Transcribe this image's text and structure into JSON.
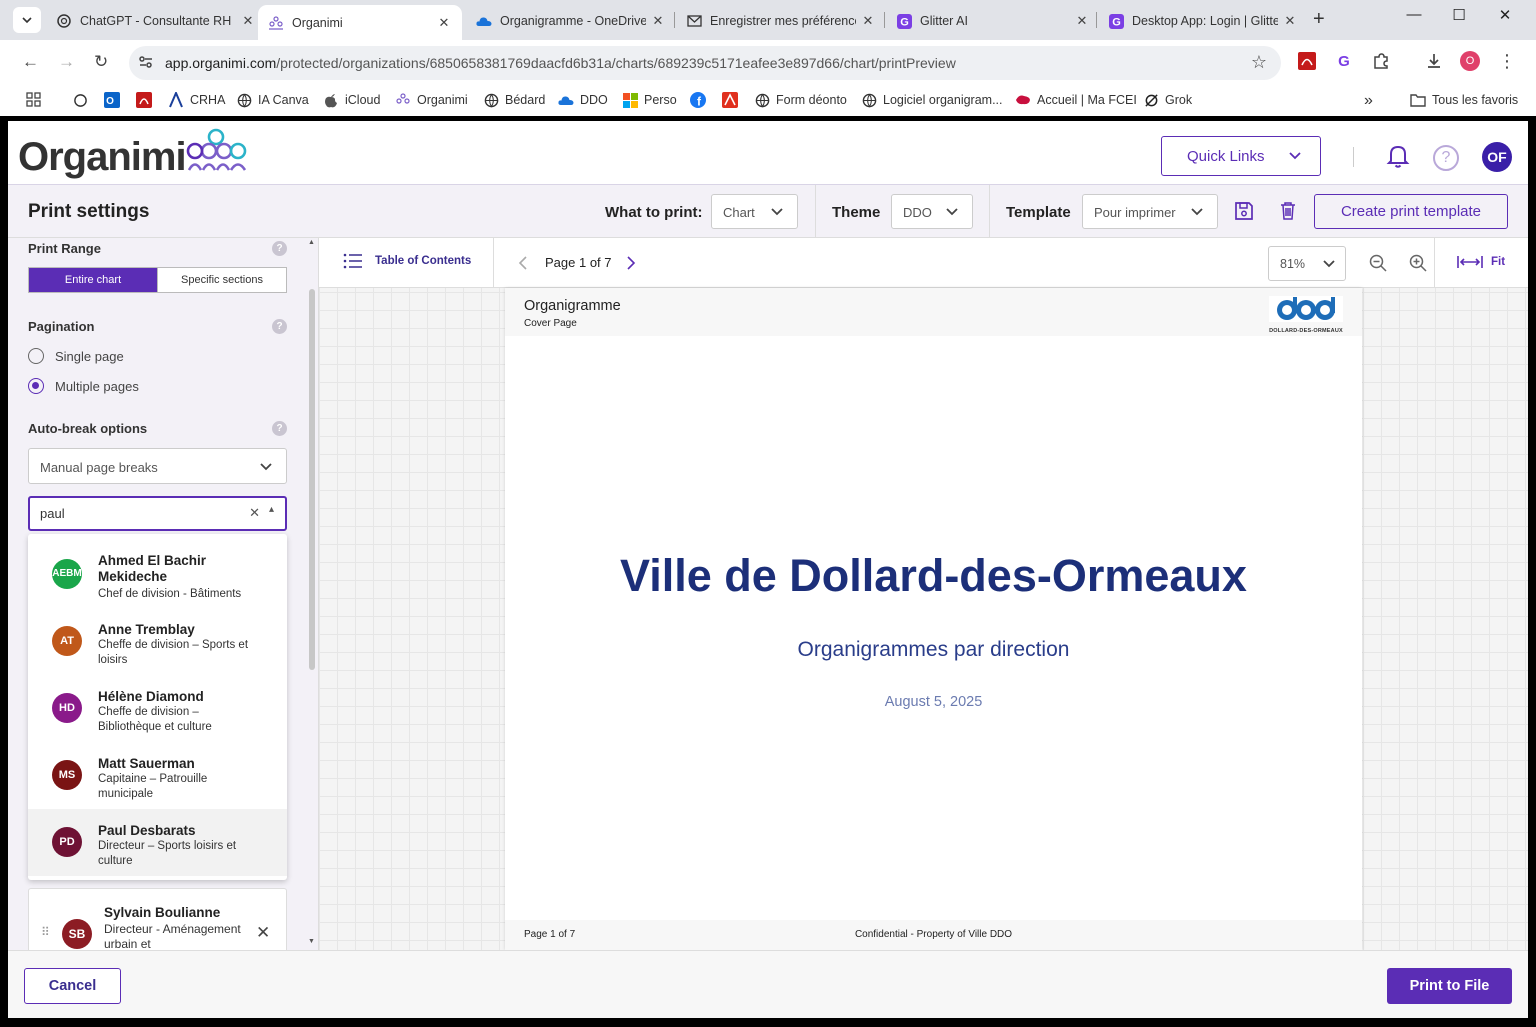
{
  "browser": {
    "tabs": [
      {
        "title": "ChatGPT - Consultante RH",
        "icon": "chatgpt-icon",
        "active": false
      },
      {
        "title": "Organimi",
        "icon": "organimi-icon",
        "active": true
      },
      {
        "title": "Organigramme - OneDrive",
        "icon": "onedrive-icon",
        "active": false
      },
      {
        "title": "Enregistrer mes préférences",
        "icon": "mail-icon",
        "active": false
      },
      {
        "title": "Glitter AI",
        "icon": "glitter-icon",
        "active": false
      },
      {
        "title": "Desktop App: Login | Glitter",
        "icon": "glitter-icon",
        "active": false
      }
    ],
    "url_domain": "app.organimi.com",
    "url_path": "/protected/organizations/6850658381769daacfd6b31a/charts/689239c5171eafee3e897d66/chart/printPreview",
    "profile_initial": "O",
    "bookmarks": [
      {
        "label": "",
        "icon": "chatgpt-icon"
      },
      {
        "label": "",
        "icon": "outlook-icon"
      },
      {
        "label": "",
        "icon": "pdf-icon"
      },
      {
        "label": "CRHA",
        "icon": "crha-icon"
      },
      {
        "label": "IA Canva",
        "icon": "globe-icon"
      },
      {
        "label": "iCloud",
        "icon": "apple-icon"
      },
      {
        "label": "Organimi",
        "icon": "organimi-icon"
      },
      {
        "label": "Bédard",
        "icon": "globe-icon"
      },
      {
        "label": "DDO",
        "icon": "onedrive-icon"
      },
      {
        "label": "Perso",
        "icon": "microsoft-icon"
      },
      {
        "label": "",
        "icon": "facebook-icon"
      },
      {
        "label": "",
        "icon": "adobe-icon"
      },
      {
        "label": "Form déonto",
        "icon": "globe-icon"
      },
      {
        "label": "Logiciel organigram...",
        "icon": "globe-icon"
      },
      {
        "label": "Accueil | Ma FCEI",
        "icon": "fcei-icon"
      },
      {
        "label": "Grok",
        "icon": "grok-icon"
      }
    ],
    "all_bookmarks_label": "Tous les favoris"
  },
  "app": {
    "brand": "Organimi",
    "quick_links_label": "Quick Links",
    "user_initials": "OF"
  },
  "print_settings": {
    "title": "Print settings",
    "what_to_print_label": "What to print:",
    "what_to_print_value": "Chart",
    "theme_label": "Theme",
    "theme_value": "DDO",
    "template_label": "Template",
    "template_value": "Pour imprimer",
    "create_template_label": "Create print template"
  },
  "left_panel": {
    "print_range_label": "Print Range",
    "range_options": [
      "Entire chart",
      "Specific sections"
    ],
    "pagination_label": "Pagination",
    "pagination_options": [
      "Single page",
      "Multiple pages"
    ],
    "pagination_selected": "Multiple pages",
    "auto_break_label": "Auto-break options",
    "auto_break_value": "Manual page breaks",
    "search_value": "paul",
    "results": [
      {
        "initials": "AEBM",
        "name": "Ahmed El Bachir Mekideche",
        "role": "Chef de division - Bâtiments",
        "color": "#1aa64a"
      },
      {
        "initials": "AT",
        "name": "Anne Tremblay",
        "role": "Cheffe de division – Sports et loisirs",
        "color": "#c0581a"
      },
      {
        "initials": "HD",
        "name": "Hélène Diamond",
        "role": "Cheffe de division – Bibliothèque et culture",
        "color": "#8a1a8a"
      },
      {
        "initials": "MS",
        "name": "Matt Sauerman",
        "role": "Capitaine – Patrouille municipale",
        "color": "#7a1414"
      },
      {
        "initials": "PD",
        "name": "Paul Desbarats",
        "role": "Directeur – Sports loisirs et culture",
        "color": "#6e1234"
      }
    ],
    "selected_card": {
      "initials": "SB",
      "name": "Sylvain Boulianne",
      "role": "Directeur - Aménagement urbain et"
    }
  },
  "preview": {
    "toc_label": "Table of Contents",
    "page_indicator": "Page 1 of 7",
    "zoom": "81%",
    "fit_label": "Fit",
    "page": {
      "header_title": "Organigramme",
      "header_subtitle": "Cover Page",
      "logo_text": "DOLLARD-DES-ORMEAUX",
      "title": "Ville de Dollard-des-Ormeaux",
      "subtitle": "Organigrammes par direction",
      "date": "August 5, 2025",
      "footer_left": "Page 1 of 7",
      "footer_center": "Confidential - Property of Ville DDO"
    }
  },
  "actions": {
    "cancel_label": "Cancel",
    "print_label": "Print to File"
  },
  "colors": {
    "accent": "#5b2db5",
    "title_navy": "#1c2f79"
  }
}
